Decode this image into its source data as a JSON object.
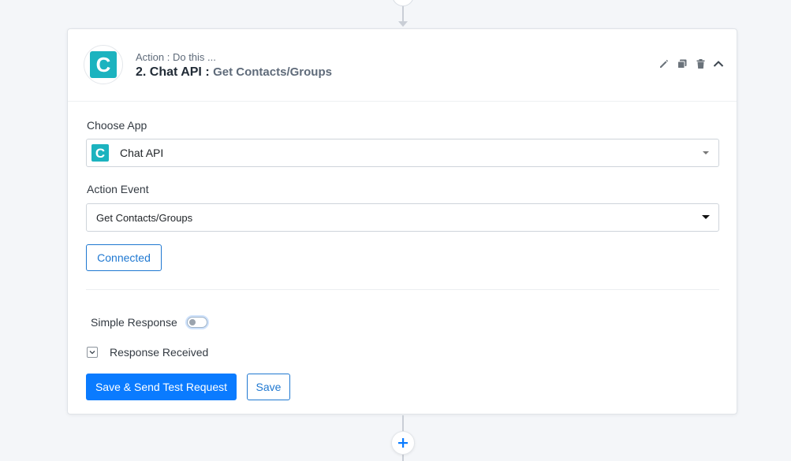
{
  "step": {
    "subtitle": "Action : Do this ...",
    "title_prefix": "2. Chat API : ",
    "event_name": "Get Contacts/Groups",
    "app_logo_letter": "C",
    "app_color": "#1cb3bf"
  },
  "header_actions": [
    {
      "icon": "pencil-icon"
    },
    {
      "icon": "copy-icon"
    },
    {
      "icon": "trash-icon"
    },
    {
      "icon": "chevron-up-icon"
    }
  ],
  "choose_app": {
    "label": "Choose App",
    "value": "Chat API",
    "logo_letter": "C"
  },
  "action_event": {
    "label": "Action Event",
    "value": "Get Contacts/Groups"
  },
  "connection": {
    "label": "Connected"
  },
  "simple_response": {
    "label": "Simple Response",
    "enabled": false
  },
  "response_received": {
    "label": "Response Received"
  },
  "buttons": {
    "save_and_test": "Save & Send Test Request",
    "save": "Save"
  },
  "colors": {
    "primary": "#0a7bff",
    "accent_outline": "#1f78d1",
    "background": "#f4f6f9"
  }
}
